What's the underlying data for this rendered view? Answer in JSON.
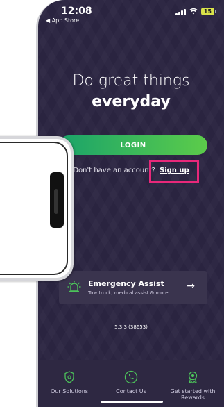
{
  "status": {
    "time": "12:08",
    "back_app": "◀ App Store",
    "battery": "15"
  },
  "hero": {
    "line1": "Do great things",
    "line2": "everyday"
  },
  "login": {
    "label": "LOGIN"
  },
  "signup": {
    "prompt": "Don't have an account? ",
    "link": "Sign up"
  },
  "emergency": {
    "title": "Emergency Assist",
    "subtitle": "Tow truck, medical assist & more",
    "arrow": "→"
  },
  "version": "5.3.3 (38653)",
  "nav": [
    {
      "label": "Our Solutions",
      "icon": "shield-icon"
    },
    {
      "label": "Contact Us",
      "icon": "phone-icon"
    },
    {
      "label": "Get started with Rewards",
      "icon": "medal-icon"
    }
  ],
  "colors": {
    "background": "#2a2440",
    "accent_green": "#1aa36a",
    "highlight": "#e8287a"
  }
}
